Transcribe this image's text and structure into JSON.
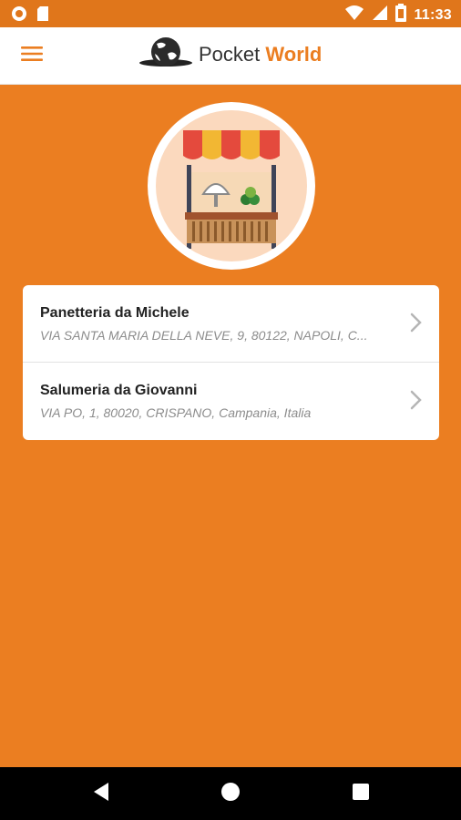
{
  "status_bar": {
    "time": "11:33",
    "icons": [
      "notification-circle-icon",
      "sd-card-icon",
      "wifi-icon",
      "signal-icon",
      "battery-icon"
    ]
  },
  "app_bar": {
    "menu_icon": "hamburger-menu-icon",
    "logo_text": "Pocket",
    "logo_accent": "World"
  },
  "hero": {
    "image": "market-stall-icon"
  },
  "shops": [
    {
      "name": "Panetteria da Michele",
      "address": " VIA SANTA MARIA DELLA NEVE, 9, 80122, NAPOLI, C..."
    },
    {
      "name": "Salumeria da Giovanni",
      "address": "VIA PO, 1, 80020, CRISPANO, Campania, Italia"
    }
  ],
  "nav_bar": {
    "back": "back-icon",
    "home": "home-icon",
    "recents": "recents-icon"
  },
  "colors": {
    "primary": "#EB7E21",
    "status_bar": "#E0761B"
  }
}
